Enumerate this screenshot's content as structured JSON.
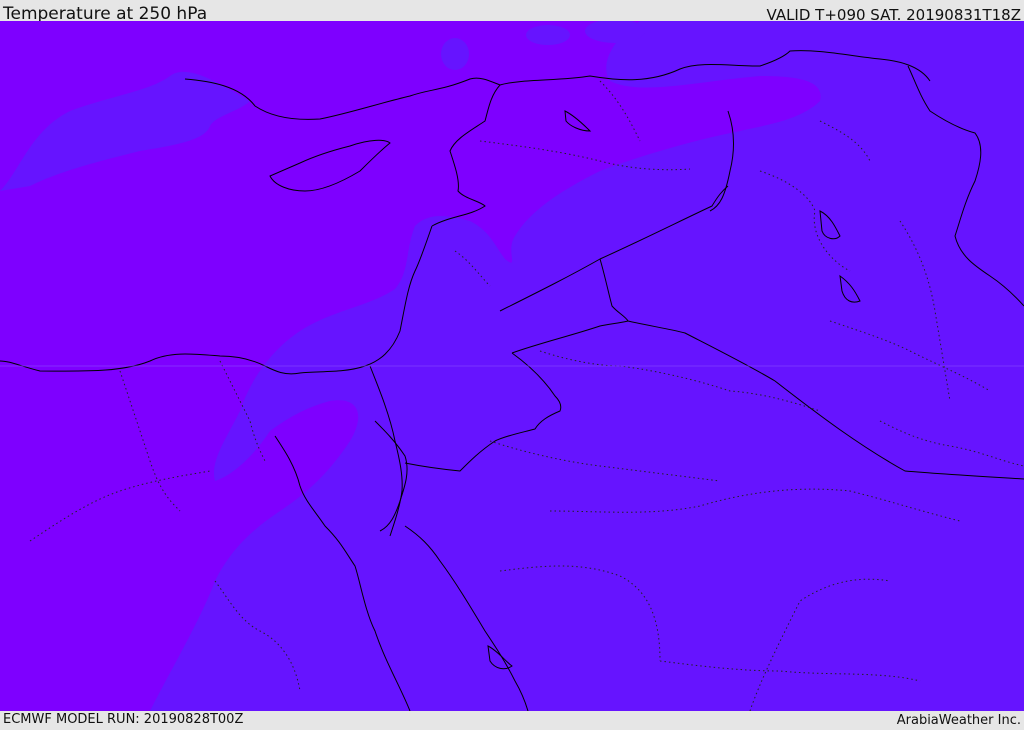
{
  "header": {
    "title": "Temperature at 250 hPa",
    "valid": "VALID T+090 SAT. 20190831T18Z"
  },
  "footer": {
    "model_run": "ECMWF MODEL RUN: 20190828T00Z",
    "credit": "ArabiaWeather Inc."
  },
  "map": {
    "field": "temperature",
    "level_hpa": 250,
    "colors": {
      "warm_band": "#7e00ff",
      "cool_band": "#6614ff",
      "coastline": "#000000",
      "border": "#000000"
    }
  }
}
